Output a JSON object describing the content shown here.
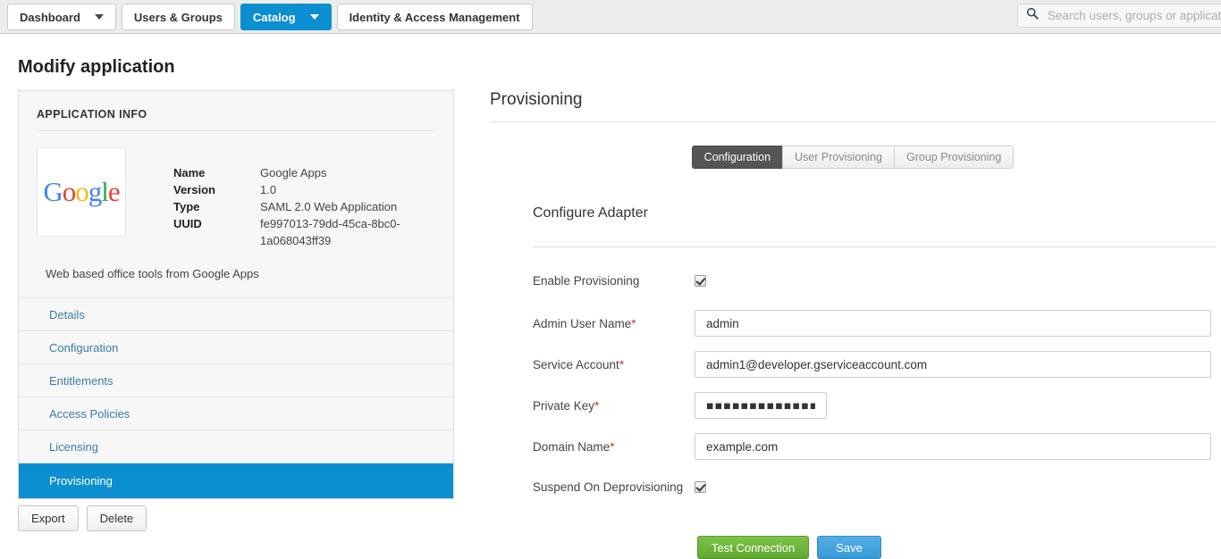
{
  "header": {
    "tabs": [
      {
        "label": "Dashboard",
        "has_caret": true,
        "active": false
      },
      {
        "label": "Users & Groups",
        "has_caret": false,
        "active": false
      },
      {
        "label": "Catalog",
        "has_caret": true,
        "active": true
      },
      {
        "label": "Identity & Access Management",
        "has_caret": false,
        "active": false
      }
    ],
    "search": {
      "placeholder": "Search users, groups or applications",
      "value": "",
      "icon": "search-icon"
    },
    "accent_color": "#0b8fd0"
  },
  "page_title": "Modify application",
  "app_info": {
    "section_label": "APPLICATION INFO",
    "logo_text": "Google",
    "fields": [
      {
        "key": "Name",
        "value": "Google Apps"
      },
      {
        "key": "Version",
        "value": "1.0"
      },
      {
        "key": "Type",
        "value": "SAML 2.0 Web Application"
      },
      {
        "key": "UUID",
        "value": "fe997013-79dd-45ca-8bc0-1a068043ff39"
      }
    ],
    "description": "Web based office tools from Google Apps",
    "nav_items": [
      {
        "label": "Details",
        "active": false
      },
      {
        "label": "Configuration",
        "active": false
      },
      {
        "label": "Entitlements",
        "active": false
      },
      {
        "label": "Access Policies",
        "active": false
      },
      {
        "label": "Licensing",
        "active": false
      },
      {
        "label": "Provisioning",
        "active": true
      }
    ],
    "actions": [
      {
        "label": "Export"
      },
      {
        "label": "Delete"
      }
    ]
  },
  "provisioning": {
    "title": "Provisioning",
    "tabs": [
      {
        "label": "Configuration",
        "active": true
      },
      {
        "label": "User Provisioning",
        "active": false
      },
      {
        "label": "Group Provisioning",
        "active": false
      }
    ],
    "section_title": "Configure Adapter",
    "fields": [
      {
        "label": "Enable Provisioning",
        "required": false,
        "type": "checkbox",
        "checked": true
      },
      {
        "label": "Admin User Name",
        "required": true,
        "type": "text",
        "value": "admin"
      },
      {
        "label": "Service Account",
        "required": true,
        "type": "text",
        "value": "admin1@developer.gserviceaccount.com"
      },
      {
        "label": "Private Key",
        "required": true,
        "type": "password",
        "value": "■■■■■■■■■■■■■■■■■■■■■■■"
      },
      {
        "label": "Domain Name",
        "required": true,
        "type": "text",
        "value": "example.com"
      },
      {
        "label": "Suspend On Deprovisioning",
        "required": false,
        "type": "checkbox",
        "checked": true
      }
    ],
    "buttons": {
      "test": {
        "label": "Test Connection",
        "color": "#62a832"
      },
      "save": {
        "label": "Save",
        "color": "#3a9ad6"
      }
    }
  }
}
